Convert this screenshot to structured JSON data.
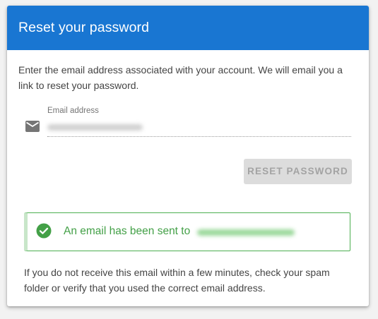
{
  "dialog": {
    "title": "Reset your password",
    "intro": "Enter the email address associated with your account. We will email you a link to reset your password."
  },
  "form": {
    "email_icon": "email-icon",
    "email_label": "Email address",
    "email_value": "",
    "submit_label": "RESET PASSWORD",
    "submit_enabled": false
  },
  "alert": {
    "icon": "check-circle-icon",
    "message": "An email has been sent to",
    "color": "#43a047"
  },
  "footer": {
    "note": "If you do not receive this email within a few minutes, check your spam folder or verify that you used the correct email address."
  },
  "theme": {
    "header_color": "#1976d2",
    "success_color": "#4caf50"
  }
}
